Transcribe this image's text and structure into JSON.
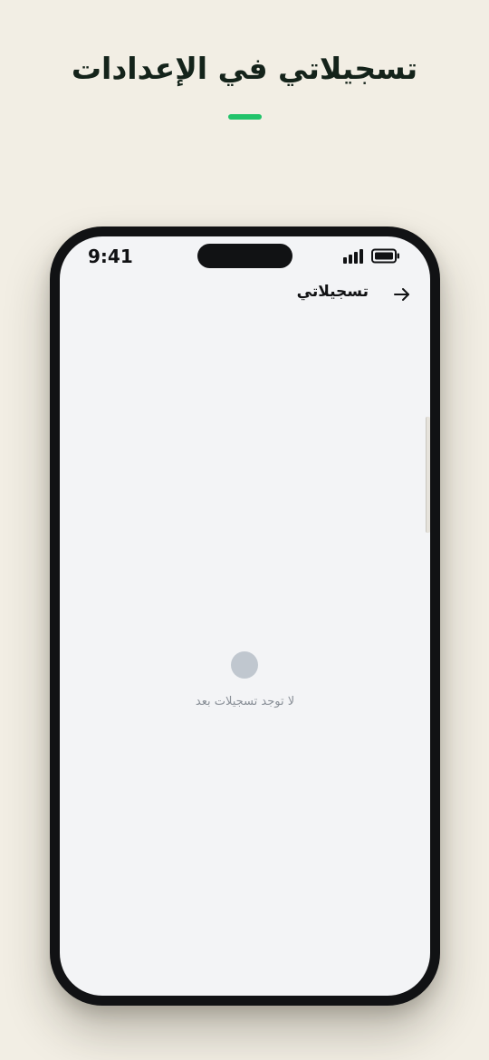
{
  "page": {
    "title": "تسجيلاتي في الإعدادات",
    "accent_color": "#22c36a",
    "background_color": "#f2eee4"
  },
  "status_bar": {
    "time": "9:41",
    "signal_icon": "signal-bars-icon",
    "battery_icon": "battery-full-icon"
  },
  "header": {
    "title": "تسجيلاتي",
    "back_icon": "arrow-right-icon"
  },
  "empty_state": {
    "icon": "empty-circle-icon",
    "message": "لا توجد تسجيلات بعد"
  }
}
